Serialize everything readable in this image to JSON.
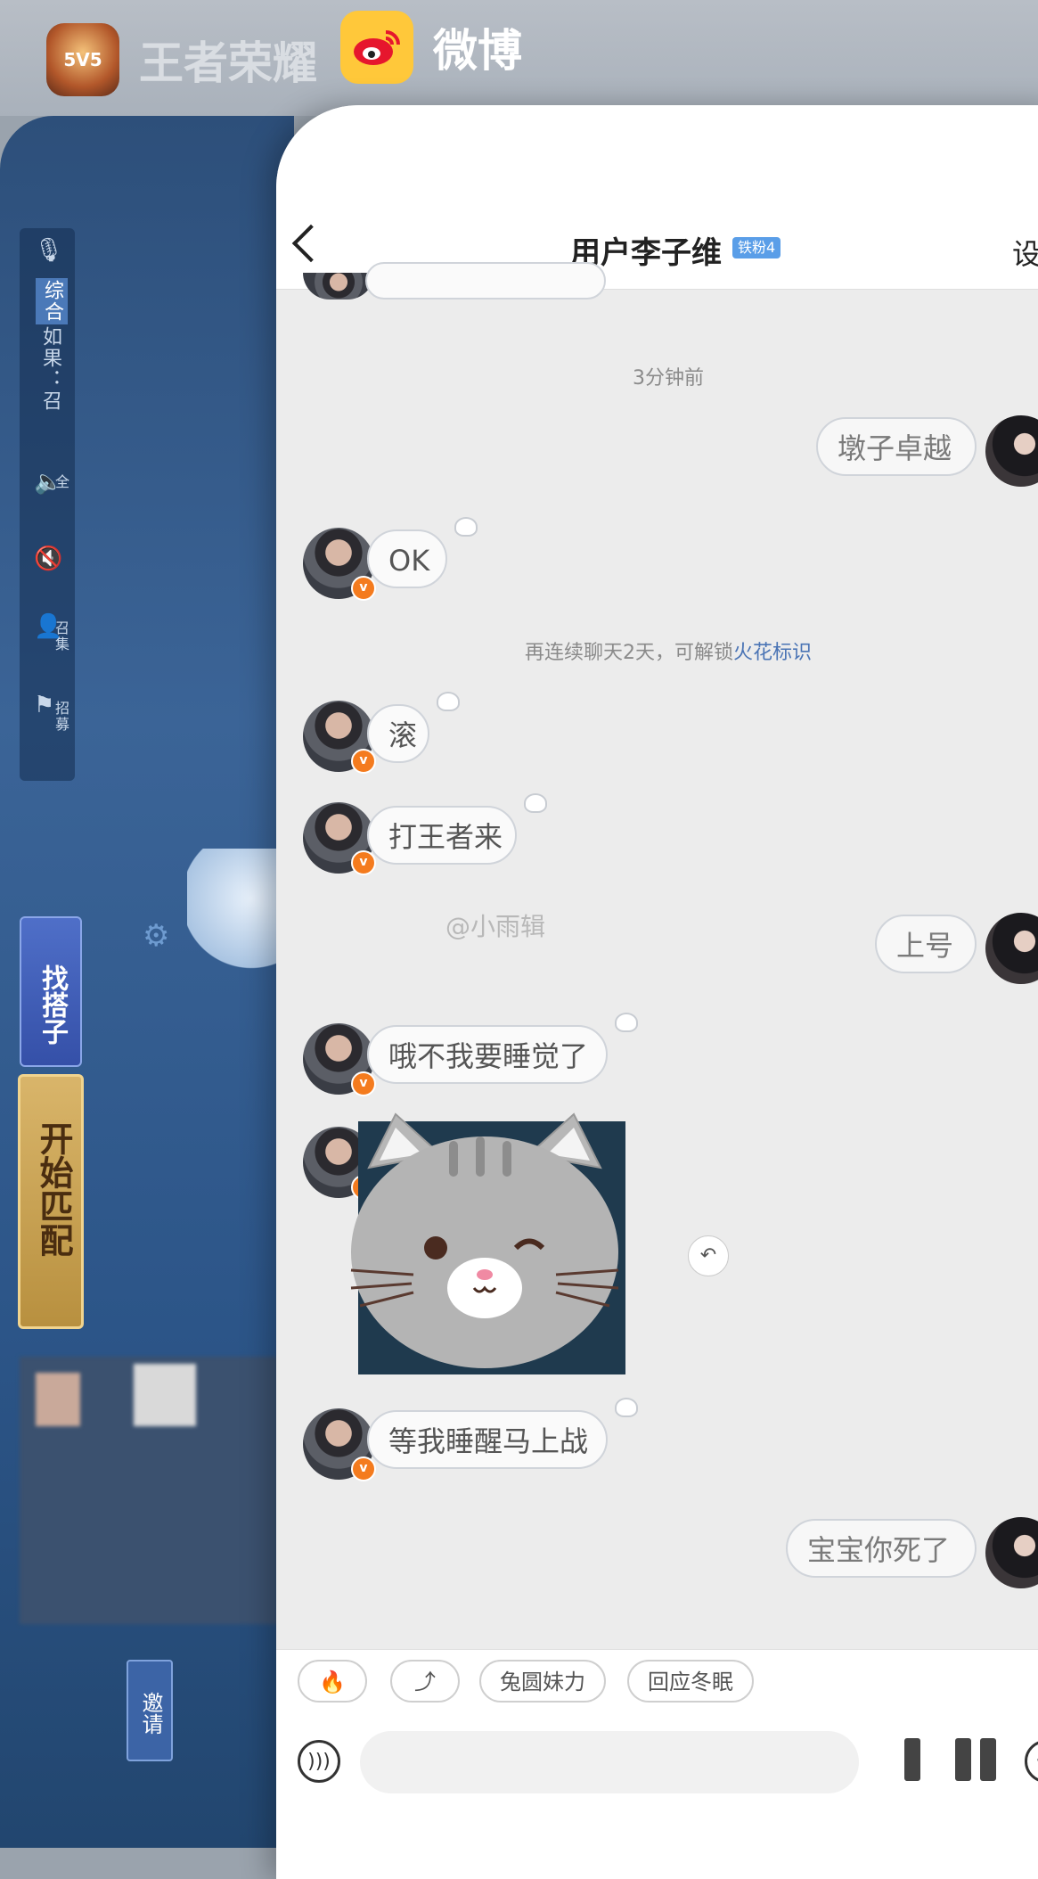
{
  "switcher": {
    "game_app_name": "王者荣耀",
    "game_icon_text": "5V5",
    "weibo_app_name": "微博"
  },
  "game": {
    "sidebar_labels": [
      "如果：召",
      "综合"
    ],
    "sidebar_small": [
      "全",
      "召集",
      "招募"
    ],
    "find_partner": "找搭子",
    "start_match": "开始匹配",
    "invite": "邀请"
  },
  "chat": {
    "title": "用户李子维",
    "fan_badge": "铁粉4",
    "settings_label": "设",
    "timestamp": "3分钟前",
    "system_tip_prefix": "再连续聊天2天，可解锁",
    "system_tip_link": "火花标识",
    "watermark": "@小雨辑",
    "messages": [
      {
        "side": "out",
        "text": "墩子卓越"
      },
      {
        "side": "in",
        "text": "OK"
      },
      {
        "side": "in",
        "text": "滚"
      },
      {
        "side": "in",
        "text": "打王者来"
      },
      {
        "side": "out",
        "text": "上号"
      },
      {
        "side": "in",
        "text": "哦不我要睡觉了"
      },
      {
        "side": "in",
        "text": "[sticker]"
      },
      {
        "side": "in",
        "text": "等我睡醒马上战"
      },
      {
        "side": "out",
        "text": "宝宝你死了"
      }
    ],
    "quick_chips": [
      "🔥",
      "⤴",
      "兔圆妹力",
      "回应冬眠"
    ],
    "input_placeholder": ""
  }
}
